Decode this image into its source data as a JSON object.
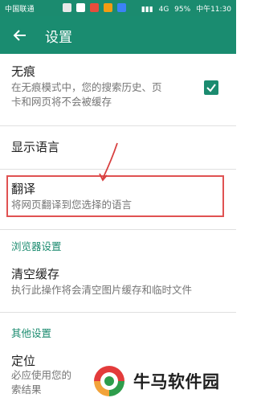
{
  "status_bar": {
    "carrier": "中国联通",
    "signal": "4G",
    "battery": "95%",
    "time": "中午11:30"
  },
  "app_bar": {
    "title": "设置"
  },
  "items": [
    {
      "title": "无痕",
      "subtitle_lines": [
        "在无痕模式中，您的搜索历史、页",
        "卡和网页将不会被缓存"
      ],
      "checked": true
    },
    {
      "title": "显示语言"
    },
    {
      "title": "翻译",
      "subtitle_lines": [
        "将网页翻译到您选择的语言"
      ]
    },
    {
      "title": "清空缓存",
      "subtitle_lines": [
        "执行此操作将会清空图片缓存和临时文件"
      ]
    },
    {
      "title": "定位",
      "subtitle_lines": [
        "必应使用您的",
        "索结果"
      ]
    }
  ],
  "sections": {
    "browser": "浏览器设置",
    "other": "其他设置"
  },
  "watermark": {
    "text": "牛马软件园"
  },
  "colors": {
    "primary": "#1b8b6f",
    "highlight": "#e05252"
  }
}
